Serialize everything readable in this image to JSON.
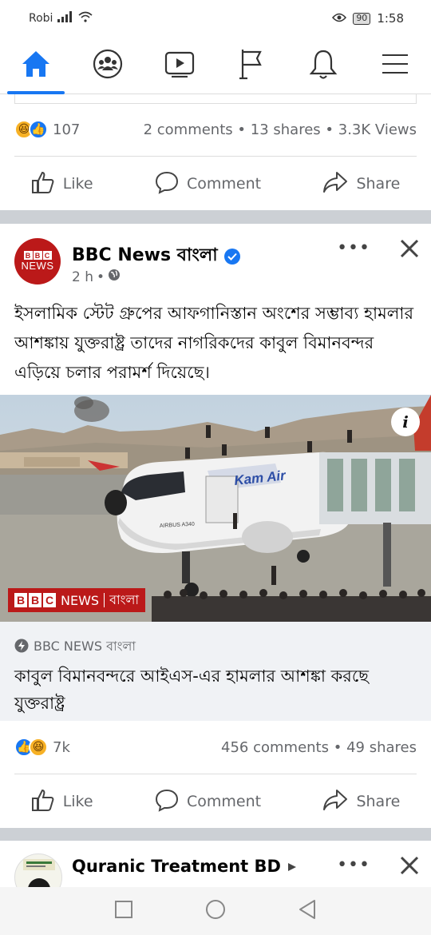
{
  "status_bar": {
    "carrier": "Robi",
    "battery": "90",
    "time": "1:58"
  },
  "nav": {
    "items": [
      {
        "name": "home",
        "active": true
      },
      {
        "name": "groups",
        "active": false
      },
      {
        "name": "watch",
        "active": false
      },
      {
        "name": "pages",
        "active": false
      },
      {
        "name": "notifications",
        "active": false
      },
      {
        "name": "menu",
        "active": false
      }
    ]
  },
  "prev_post": {
    "reaction_count": "107",
    "comments": "2 comments",
    "shares": "13 shares",
    "views": "3.3K Views",
    "sep": "•"
  },
  "actions": {
    "like": "Like",
    "comment": "Comment",
    "share": "Share"
  },
  "post": {
    "page_name": "BBC News বাংলা",
    "avatar_letters": [
      "B",
      "B",
      "C"
    ],
    "avatar_word": "NEWS",
    "time": "2 h",
    "sep": "•",
    "more": "•••",
    "text": "ইসলামিক স্টেট গ্রুপের আফগানিস্তান অংশের সম্ভাব্য হামলার আশঙ্কায় যুক্তরাষ্ট্র তাদের নাগরিকদের কাবুল বিমানবন্দর এড়িয়ে চলার পরামর্শ দিয়েছে।",
    "image": {
      "info_label": "i",
      "badge_letters": [
        "B",
        "B",
        "C"
      ],
      "badge_news": "NEWS",
      "badge_lang": "বাংলা",
      "plane_brand": "Kam Air",
      "plane_model": "AIRBUS A340"
    },
    "link": {
      "source": "BBC NEWS বাংলা",
      "title": "কাবুল বিমানবন্দরে আইএস-এর হামলার আশঙ্কা করছে যুক্তরাষ্ট্র"
    },
    "reaction_count": "7k",
    "comments": "456 comments",
    "shares": "49 shares"
  },
  "next_post": {
    "page_name": "Quranic Treatment BD",
    "more": "•••"
  },
  "colors": {
    "facebook_blue": "#1877f2",
    "bbc_red": "#bb1919",
    "grey_text": "#65676b",
    "band": "#ccd0d5"
  }
}
